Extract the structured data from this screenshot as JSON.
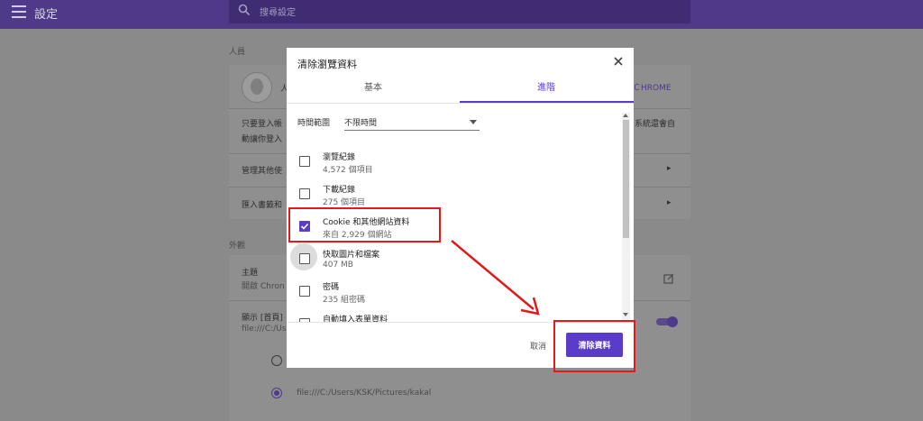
{
  "header": {
    "title": "設定",
    "search_placeholder": "搜尋設定"
  },
  "background_page": {
    "people_section": "人員",
    "profile_initial": "人",
    "sync_link": "ＣHROME",
    "sync_text_line1": "只要登入帳",
    "sync_text_line1_right": "系統還會自",
    "sync_text_line2": "動讓你登入",
    "manage_others": "管理其他使",
    "import_bookmarks": "匯入書籤和",
    "appearance_section": "外觀",
    "theme_title": "主題",
    "theme_sub": "開啟 Chron",
    "home_button_title": "顯示 [首頁]",
    "home_button_sub": "file:///C:/Us",
    "home_url": "file:///C:/Users/KSK/Pictures/kakal"
  },
  "dialog": {
    "title": "清除瀏覽資料",
    "tabs": [
      {
        "label": "基本",
        "active": false
      },
      {
        "label": "進階",
        "active": true
      }
    ],
    "time_range_label": "時間範圍",
    "time_range_value": "不限時間",
    "items": [
      {
        "title": "瀏覽紀錄",
        "subtitle": "4,572 個項目",
        "checked": false
      },
      {
        "title": "下載紀錄",
        "subtitle": "275 個項目",
        "checked": false
      },
      {
        "title": "Cookie 和其他網站資料",
        "subtitle": "來自 2,929 個網站",
        "checked": true
      },
      {
        "title": "快取圖片和檔案",
        "subtitle": "407 MB",
        "checked": false
      },
      {
        "title": "密碼",
        "subtitle": "235 組密碼",
        "checked": false
      },
      {
        "title": "自動填入表單資料",
        "subtitle": "",
        "checked": false
      }
    ],
    "cancel_label": "取消",
    "clear_label": "清除資料"
  },
  "colors": {
    "accent": "#5a3cc8",
    "topbar": "#4f3a8a",
    "annotation": "#e01b1b"
  }
}
